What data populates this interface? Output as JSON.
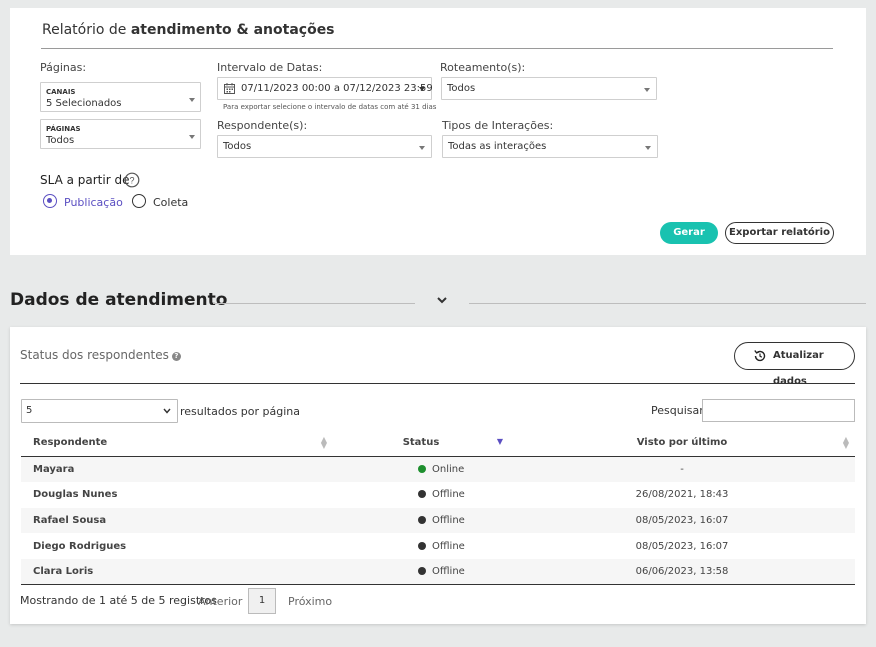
{
  "report": {
    "title_prefix": "Relatório de ",
    "title_bold": "atendimento & anotações",
    "paginas_label": "Páginas:",
    "canais": {
      "small": "CANAIS",
      "value": "5 Selecionados"
    },
    "paginas": {
      "small": "PÁGINAS",
      "value": "Todos"
    },
    "date_label": "Intervalo de Datas:",
    "date_value": "07/11/2023 00:00 a 07/12/2023 23:59",
    "date_hint": "Para exportar selecione o intervalo de datas com até 31 dias",
    "routing_label": "Roteamento(s):",
    "routing_value": "Todos",
    "respondent_label": "Respondente(s):",
    "respondent_value": "Todos",
    "interaction_label": "Tipos de Interações:",
    "interaction_value": "Todas as interações",
    "sla_label": "SLA a partir de",
    "sla_options": [
      "Publicação",
      "Coleta"
    ],
    "sla_selected": "Publicação",
    "generate_label": "Gerar",
    "export_label": "Exportar relatório"
  },
  "section": {
    "title": "Dados de atendimento"
  },
  "status": {
    "title": "Status dos respondentes",
    "refresh_label": "Atualizar dados",
    "page_size": "5",
    "page_size_suffix": "resultados por página",
    "search_label": "Pesquisar",
    "search_value": "",
    "columns": [
      "Respondente",
      "Status",
      "Visto por último"
    ],
    "rows": [
      {
        "name": "Mayara",
        "status": "Online",
        "last_seen": "-"
      },
      {
        "name": "Douglas Nunes",
        "status": "Offline",
        "last_seen": "26/08/2021, 18:43"
      },
      {
        "name": "Rafael Sousa",
        "status": "Offline",
        "last_seen": "08/05/2023, 16:07"
      },
      {
        "name": "Diego Rodrigues",
        "status": "Offline",
        "last_seen": "08/05/2023, 16:07"
      },
      {
        "name": "Clara Loris",
        "status": "Offline",
        "last_seen": "06/06/2023, 13:58"
      }
    ],
    "footer": "Mostrando de 1 até 5 de 5 registros",
    "prev_label": "Anterior",
    "page_number": "1",
    "next_label": "Próximo"
  },
  "colors": {
    "accent": "#19c2b0",
    "radio_selected": "#5b4fc2",
    "online": "#1e8f2e",
    "offline": "#333333"
  }
}
